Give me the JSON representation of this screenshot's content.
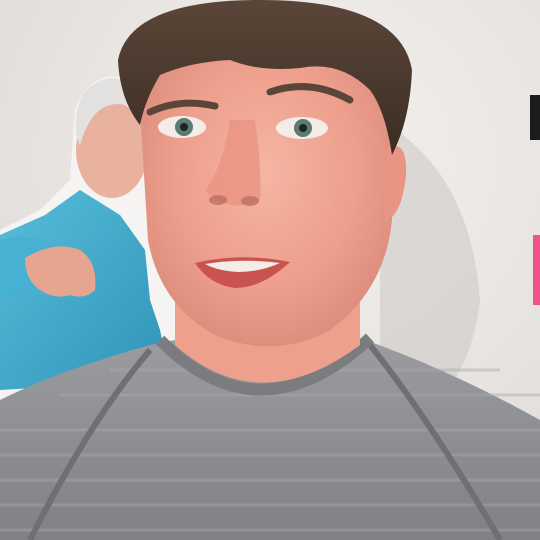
{
  "scene": {
    "subject": "person-speaking-to-camera",
    "background_color": "#ebe8e5",
    "accent_colors": {
      "shirt": "#8e9093",
      "cutout_shirt": "#3fa7c9",
      "pink_sign": "#f0528c",
      "hair": "#4a3a2e",
      "skin": "#f0a694"
    }
  }
}
